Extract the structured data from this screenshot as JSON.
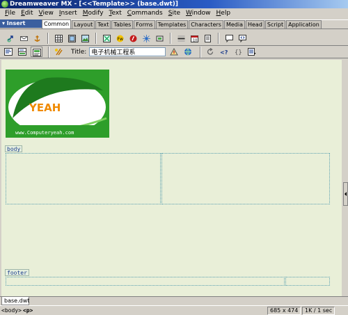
{
  "window": {
    "title": "Dreamweaver MX - [<<Template>> (base.dwt)]"
  },
  "menu": [
    {
      "u": "F",
      "rest": "ile"
    },
    {
      "u": "E",
      "rest": "dit"
    },
    {
      "u": "V",
      "rest": "iew"
    },
    {
      "u": "I",
      "rest": "nsert"
    },
    {
      "u": "M",
      "rest": "odify"
    },
    {
      "u": "T",
      "rest": "ext"
    },
    {
      "u": "C",
      "rest": "ommands"
    },
    {
      "u": "S",
      "rest": "ite"
    },
    {
      "u": "W",
      "rest": "indow"
    },
    {
      "u": "H",
      "rest": "elp"
    }
  ],
  "insert": {
    "label": "▾ Insert",
    "tabs": [
      "Common",
      "Layout",
      "Text",
      "Tables",
      "Forms",
      "Templates",
      "Characters",
      "Media",
      "Head",
      "Script",
      "Application"
    ],
    "active_tab": "Common"
  },
  "doc_toolbar": {
    "title_label": "Title:",
    "title_value": "电子机械工程系"
  },
  "logo": {
    "text": "YEAH",
    "url": "www.Computeryeah.com"
  },
  "regions": {
    "body": "body",
    "footer": "footer"
  },
  "doc_tab": "base.dwt",
  "status": {
    "tags": [
      "<body>",
      "<p>"
    ],
    "size": "685 x 474",
    "download": "1K / 1 sec"
  }
}
